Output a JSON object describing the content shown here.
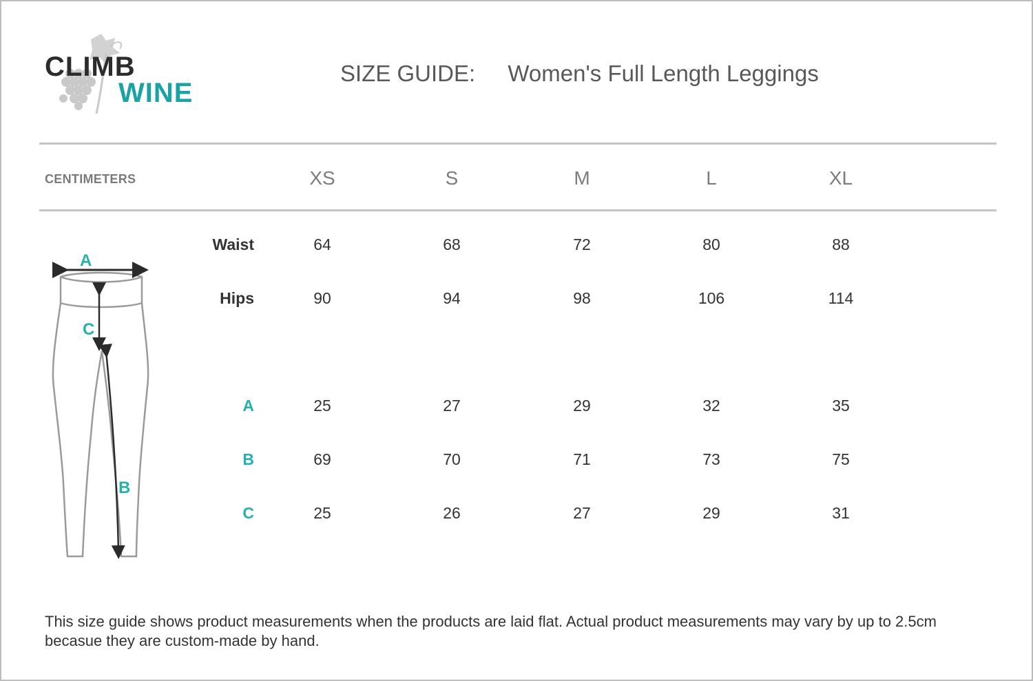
{
  "brand": {
    "line1": "CLIMB",
    "line2": "WINE",
    "accent_color": "#1aa3a3",
    "dark_color": "#2c2c2c"
  },
  "header": {
    "label": "SIZE GUIDE:",
    "product": "Women's Full Length Leggings"
  },
  "table": {
    "unit_label": "CENTIMETERS",
    "sizes": [
      "XS",
      "S",
      "M",
      "L",
      "XL"
    ],
    "rows": [
      {
        "label": "Waist",
        "style": "bold",
        "values": [
          "64",
          "68",
          "72",
          "80",
          "88"
        ]
      },
      {
        "label": "Hips",
        "style": "bold",
        "values": [
          "90",
          "94",
          "98",
          "106",
          "114"
        ]
      },
      {
        "label": "A",
        "style": "teal",
        "values": [
          "25",
          "27",
          "29",
          "32",
          "35"
        ]
      },
      {
        "label": "B",
        "style": "teal",
        "values": [
          "69",
          "70",
          "71",
          "73",
          "75"
        ]
      },
      {
        "label": "C",
        "style": "teal",
        "values": [
          "25",
          "26",
          "27",
          "29",
          "31"
        ]
      }
    ]
  },
  "diagram": {
    "labels": {
      "a": "A",
      "b": "B",
      "c": "C"
    },
    "icon": "leggings-measurement-diagram"
  },
  "footnote": "This size guide shows product measurements when the products are laid flat. Actual product measurements may vary by up to 2.5cm becasue they are custom-made by hand."
}
